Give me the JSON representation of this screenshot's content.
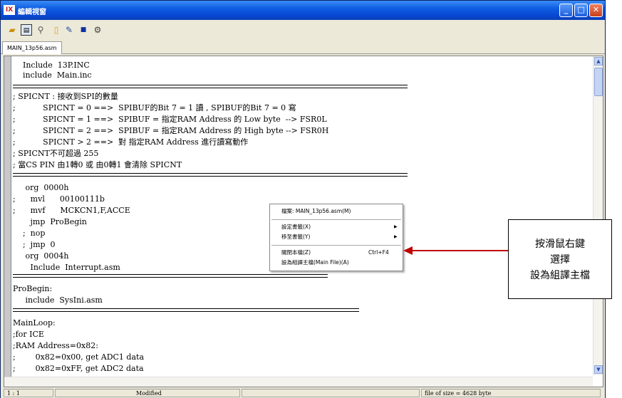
{
  "window": {
    "title": "編輯視窗",
    "app_icon_text": "IX"
  },
  "toolbar": {
    "icons": [
      "open-folder-icon",
      "save-icon",
      "search-icon",
      "new-file-icon",
      "edit-icon",
      "stop-icon",
      "build-icon"
    ]
  },
  "tab": {
    "label": "MAIN_13p56.asm"
  },
  "code": {
    "lines": [
      "    Include  13P.INC",
      "    include  Main.inc",
      "; SPICNT : 接收到SPI的數量",
      ";           SPICNT = 0 ==>  SPIBUF的Bit 7 = 1 讀 , SPIBUF的Bit 7 = 0 寫",
      ";           SPICNT = 1 ==>  SPIBUF = 指定RAM Address 的 Low byte  --> FSR0L",
      ";           SPICNT = 2 ==>  SPIBUF = 指定RAM Address 的 High byte --> FSR0H",
      ";           SPICNT > 2 ==>  對 指定RAM Address 進行讀寫動作",
      "; SPICNT不可超過 255",
      "; 當CS PIN 由1轉0 或 由0轉1 會清除 SPICNT",
      "     org  0000h",
      ";      mvl      00100111b",
      ";      mvf      MCKCN1,F,ACCE",
      "       jmp  ProBegin",
      "    ;  nop",
      "    ;  jmp  0",
      "     org  0004h",
      "       Include  Interrupt.asm",
      "ProBegin:",
      "     include  SysIni.asm",
      "MainLoop:",
      ";for ICE",
      ";RAM Address=0x82:",
      ";        0x82=0x00, get ADC1 data",
      ";        0x82=0xFF, get ADC2 data"
    ]
  },
  "context_menu": {
    "items": [
      {
        "label": "檔案: MAIN_13p56.asm(M)",
        "shortcut": "",
        "submenu": false
      },
      {
        "label": "設定書籤(X)",
        "shortcut": "",
        "submenu": true
      },
      {
        "label": "移至書籤(Y)",
        "shortcut": "",
        "submenu": true
      },
      {
        "label": "關閉本檔(Z)",
        "shortcut": "Ctrl+F4",
        "submenu": false
      },
      {
        "label": "設為組譯主檔(Main File)(A)",
        "shortcut": "",
        "submenu": false
      }
    ]
  },
  "callout": {
    "lines": [
      "按滑鼠右鍵",
      "選擇",
      "設為組譯主檔"
    ]
  },
  "status": {
    "position": "1 : 1",
    "state": "Modified",
    "size": "file of size = 4628 byte"
  },
  "colors": {
    "titlebar": "#0846d1",
    "arrow": "#c00000"
  }
}
